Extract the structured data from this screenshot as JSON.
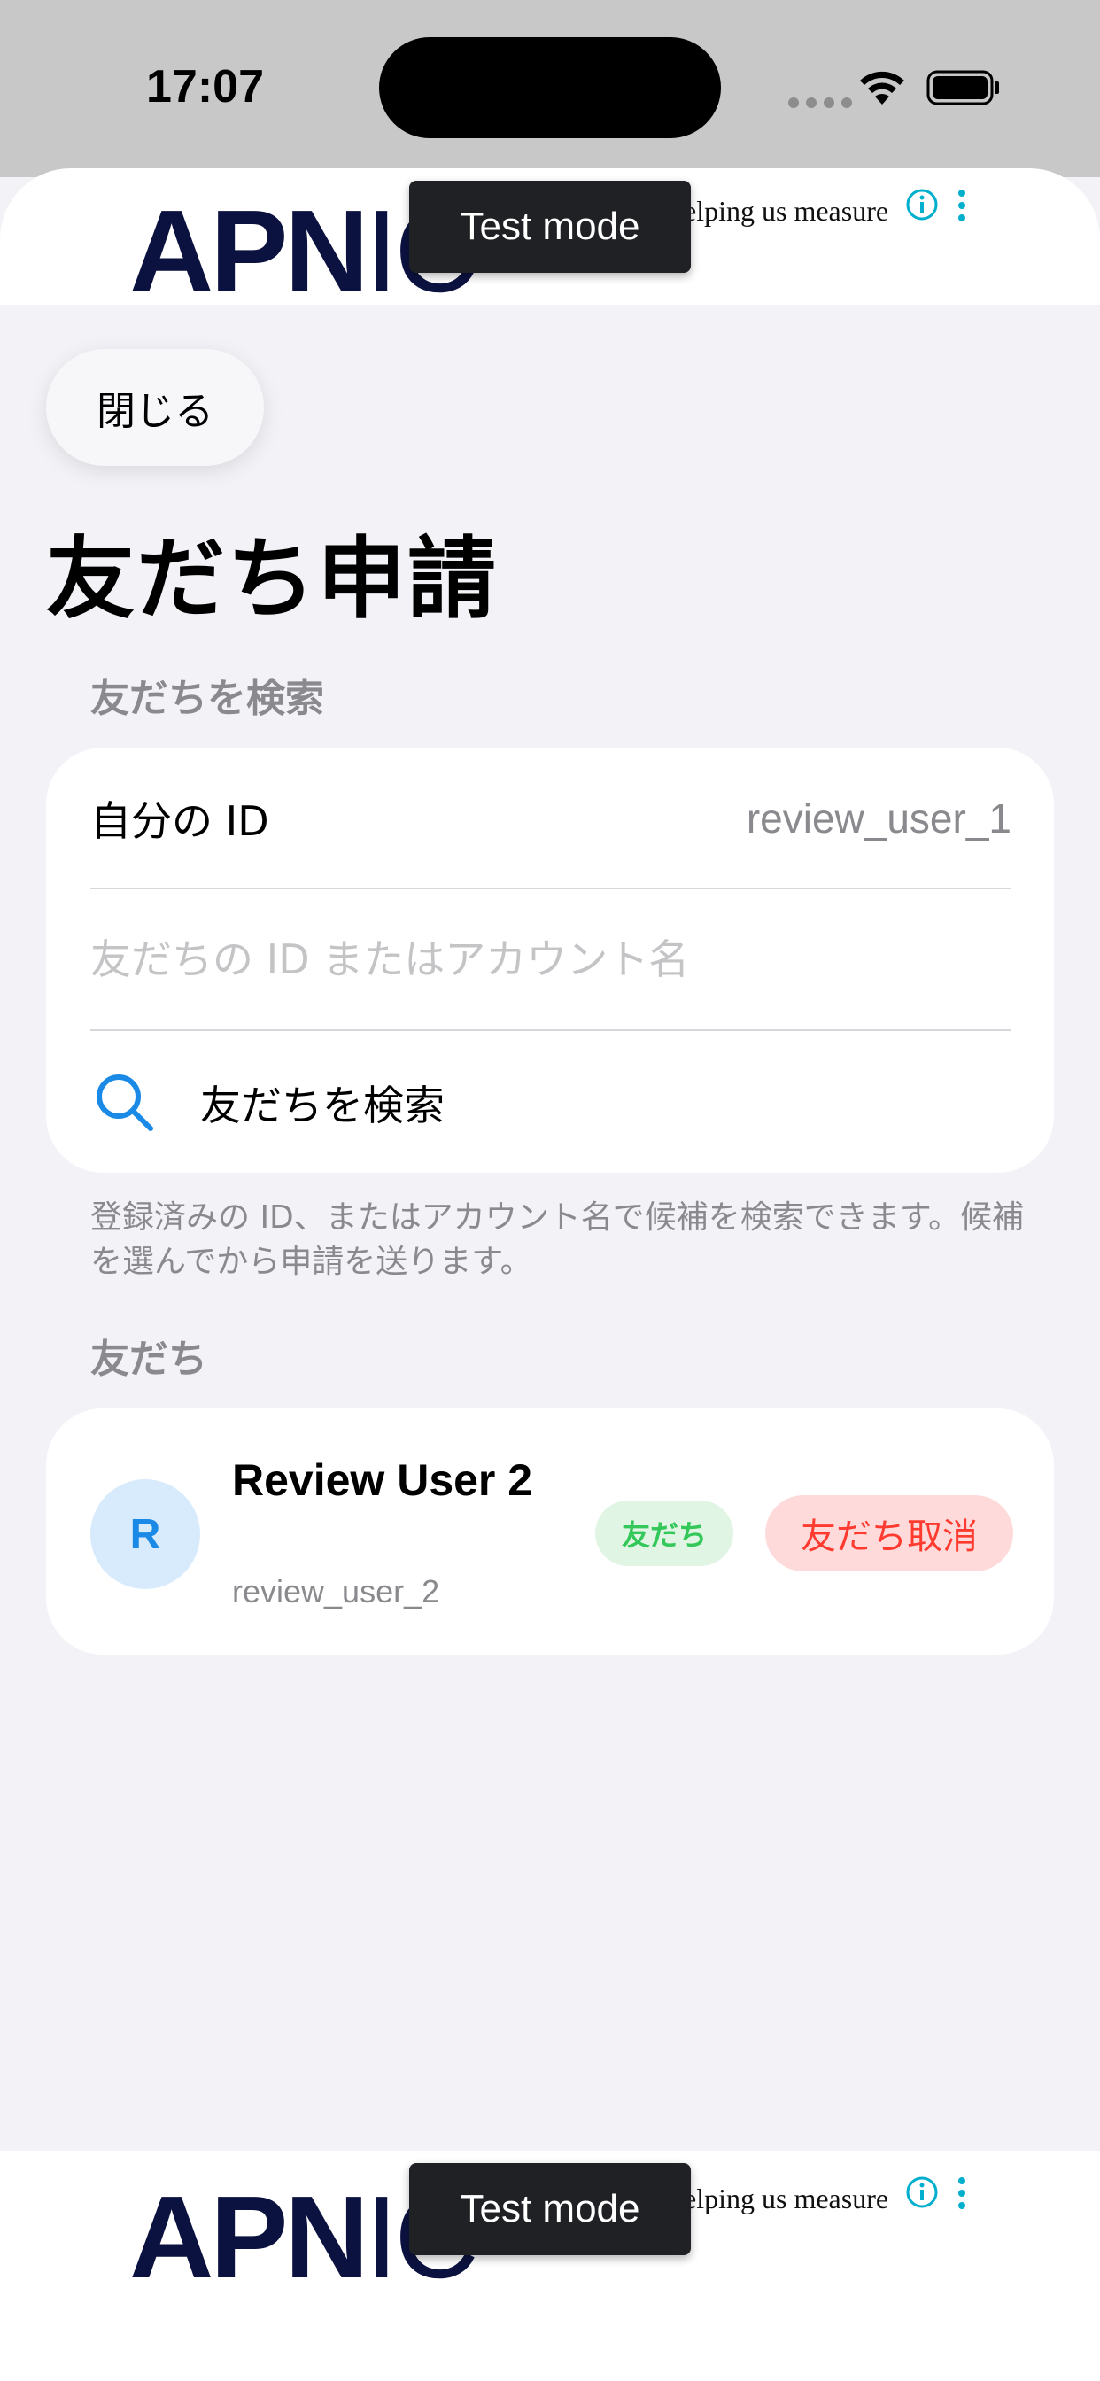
{
  "status_bar": {
    "time": "17:07"
  },
  "ads": {
    "logo_bold": "APN",
    "logo_thin": "I",
    "logo_tail": "C",
    "tagline": "elping us measure",
    "test_badge": "Test mode"
  },
  "nav": {
    "close_label": "閉じる"
  },
  "page": {
    "title": "友だち申請"
  },
  "search_section": {
    "header": "友だちを検索",
    "my_id_label": "自分の ID",
    "my_id_value": "review_user_1",
    "input_placeholder": "友だちの ID またはアカウント名",
    "input_value": "",
    "search_label": "友だちを検索",
    "helper_text": "登録済みの ID、またはアカウント名で候補を検索できます。候補を選んでから申請を送ります。"
  },
  "friends_section": {
    "header": "友だち",
    "friends": [
      {
        "avatar_initial": "R",
        "name": "Review User 2",
        "id": "review_user_2",
        "badge": "友だち",
        "action_label": "友だち取消"
      }
    ]
  },
  "colors": {
    "accent": "#1a8ae6",
    "friend_badge_text": "#34c759",
    "destructive": "#ff3b30",
    "background": "#f2f2f7"
  },
  "icons": {
    "search": "search-icon",
    "info": "info-icon",
    "menu": "more-vertical-icon",
    "wifi": "wifi-icon",
    "battery": "battery-icon"
  }
}
